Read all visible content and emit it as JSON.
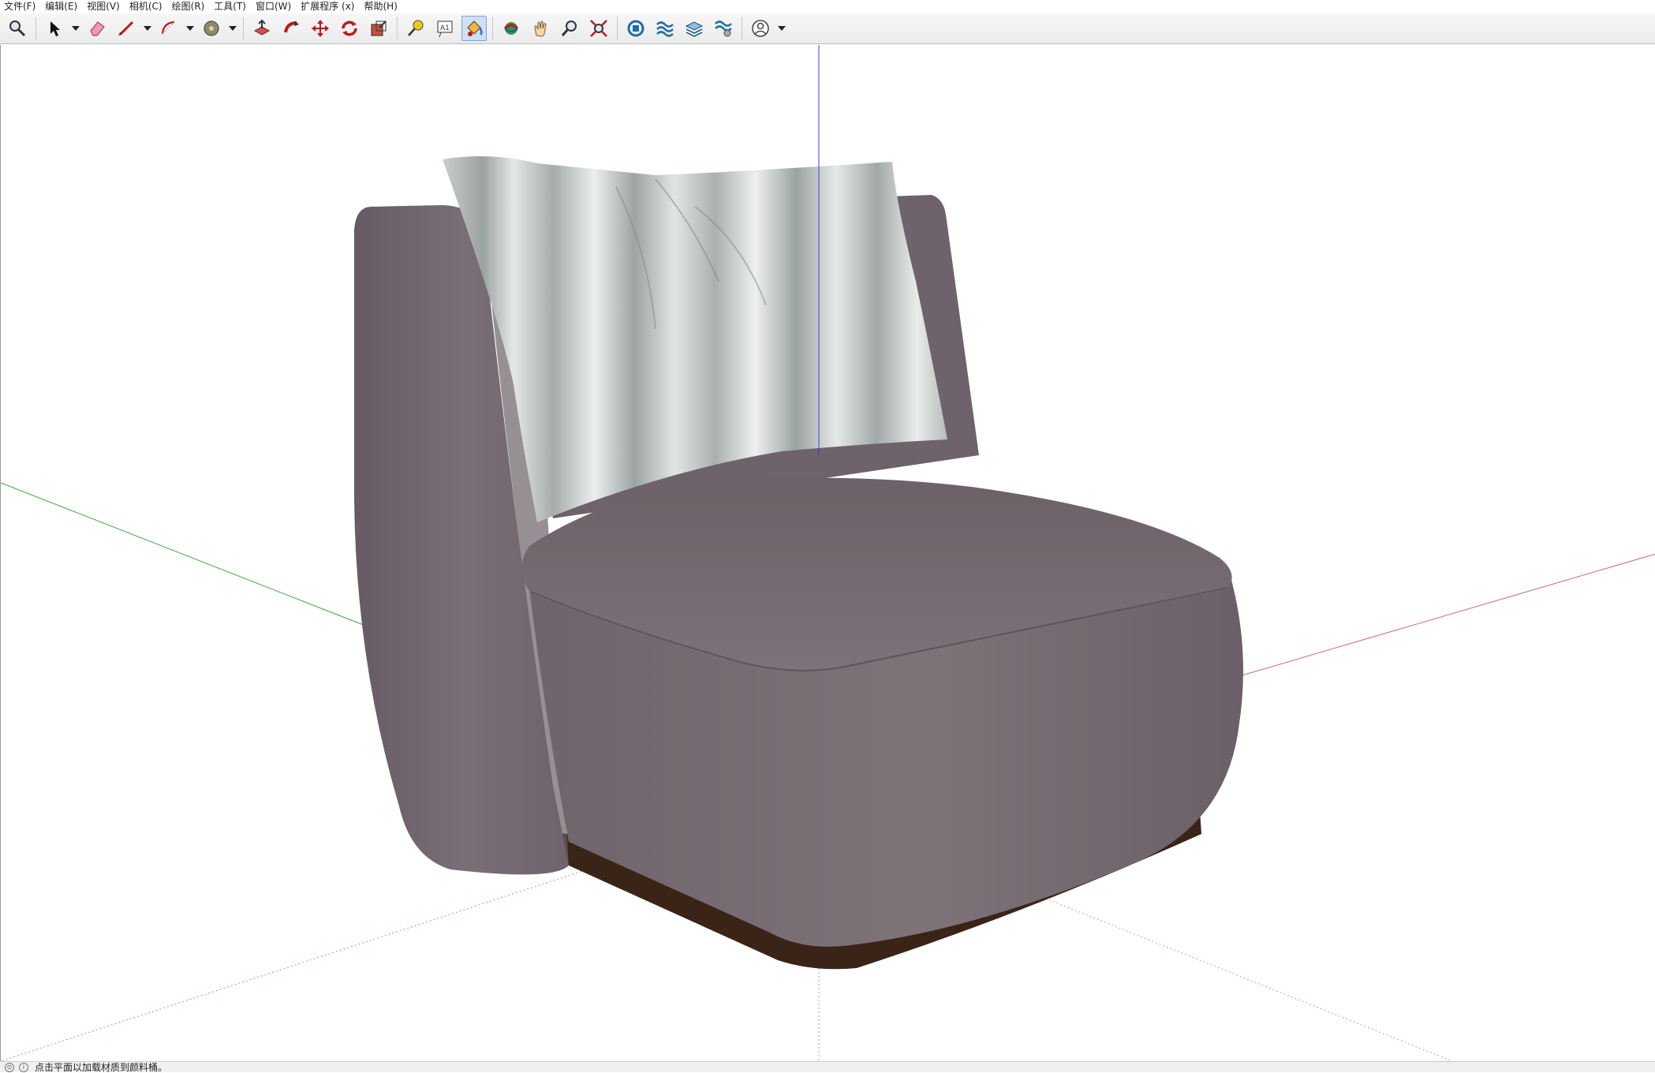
{
  "menu": {
    "items": [
      "文件(F)",
      "编辑(E)",
      "视图(V)",
      "相机(C)",
      "绘图(R)",
      "工具(T)",
      "窗口(W)",
      "扩展程序 (x)",
      "帮助(H)"
    ]
  },
  "toolbar": {
    "buttons": [
      {
        "icon": "zoom-icon"
      },
      {
        "icon": "select-icon",
        "dropdown": true
      },
      {
        "icon": "eraser-icon"
      },
      {
        "icon": "line-icon",
        "dropdown": true
      },
      {
        "icon": "arc-icon",
        "dropdown": true
      },
      {
        "icon": "circle-icon",
        "dropdown": true
      },
      {
        "icon": "push-pull-icon"
      },
      {
        "icon": "follow-me-icon"
      },
      {
        "icon": "move-icon"
      },
      {
        "icon": "rotate-icon"
      },
      {
        "icon": "scale-icon"
      },
      {
        "icon": "tape-measure-icon"
      },
      {
        "icon": "text-icon",
        "label": "A1"
      },
      {
        "icon": "paint-bucket-icon",
        "active": true
      },
      {
        "icon": "orbit-icon"
      },
      {
        "icon": "pan-icon"
      },
      {
        "icon": "zoom-tool-icon"
      },
      {
        "icon": "zoom-extents-icon"
      },
      {
        "icon": "warehouse-icon"
      },
      {
        "icon": "extension-warehouse-icon"
      },
      {
        "icon": "layers-icon"
      },
      {
        "icon": "extension-manager-icon"
      },
      {
        "icon": "account-icon",
        "dropdown": true
      }
    ]
  },
  "status": {
    "message": "点击平面以加载材质到颜料桶。"
  },
  "colors": {
    "axis_red": "#d36a6a",
    "axis_green": "#3aa63a",
    "axis_blue": "#3a3ad6",
    "sofa_body": "#7a6f77",
    "pillow_stripe": "#9aa3a2",
    "base": "#3a2418"
  }
}
